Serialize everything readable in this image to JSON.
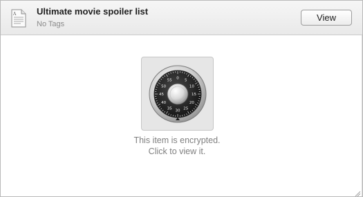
{
  "note": {
    "title": "Ultimate movie spoiler list",
    "tags": "No Tags",
    "icon": "document-note-icon"
  },
  "toolbar": {
    "view_label": "View"
  },
  "encrypted": {
    "icon": "combination-lock-icon",
    "line1": "This item is encrypted.",
    "line2": "Click to view it.",
    "dial_numbers": [
      "0",
      "5",
      "10",
      "15",
      "20",
      "25",
      "30",
      "35",
      "40",
      "45",
      "50",
      "55"
    ]
  },
  "colors": {
    "header_bg": "#ececec",
    "tile_bg": "#e6e6e6",
    "secondary_text": "#7f7f7f"
  }
}
